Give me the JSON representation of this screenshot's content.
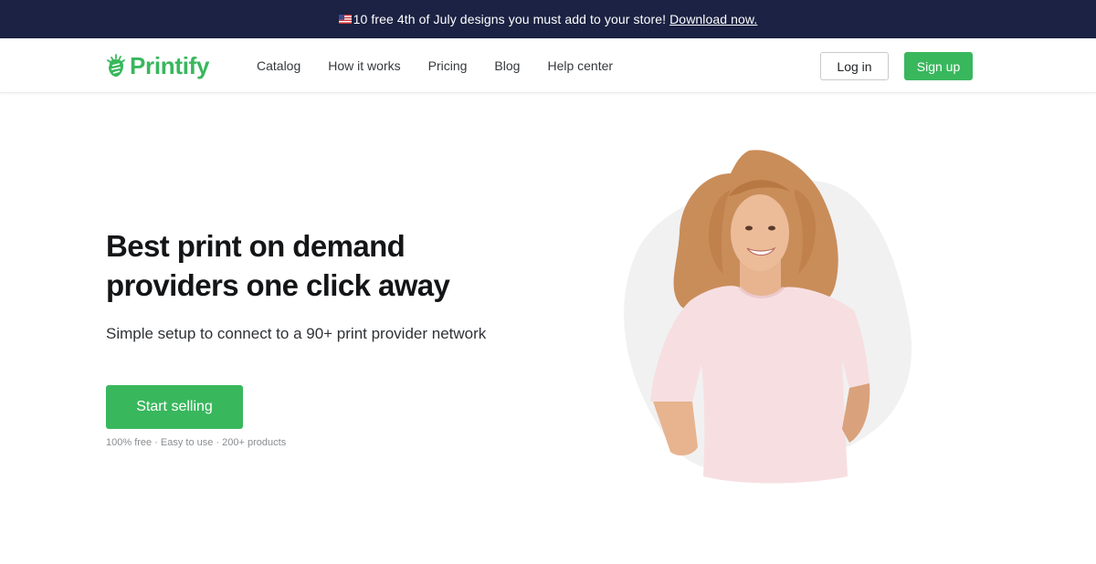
{
  "announcement": {
    "flag_icon": "us-flag-icon",
    "text": "10 free 4th of July designs you must add to your store!",
    "link": "Download now."
  },
  "header": {
    "brand": "Printify",
    "nav": [
      "Catalog",
      "How it works",
      "Pricing",
      "Blog",
      "Help center"
    ],
    "login_label": "Log in",
    "signup_label": "Sign up"
  },
  "hero": {
    "title_line1": "Best print on demand",
    "title_line2": "providers one click away",
    "subtitle": "Simple setup to connect to a 90+ print provider network",
    "cta_label": "Start selling",
    "note": "100% free · Easy to use  · 200+ products"
  },
  "colors": {
    "brand_green": "#39b75d",
    "announcement_bg": "#1b2243",
    "text_dark": "#141517"
  }
}
